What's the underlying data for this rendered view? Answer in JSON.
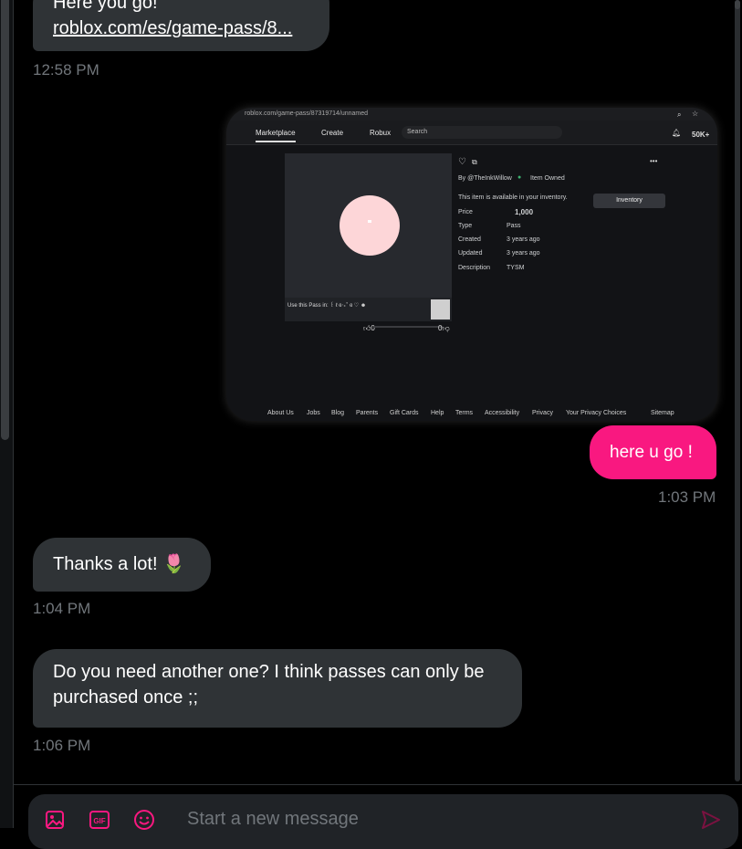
{
  "messages": {
    "first": {
      "line1": "Here you go!",
      "link": "roblox.com/es/game-pass/8...",
      "time": "12:58 PM"
    },
    "sent": {
      "text": "here u go !",
      "time": "1:03 PM"
    },
    "thanks": {
      "text": "Thanks a lot! 🌷",
      "time": "1:04 PM"
    },
    "question": {
      "line1": "Do you need another one? I think passes can only be",
      "line2": "purchased once ;;",
      "time": "1:06 PM"
    }
  },
  "shared_image": {
    "url": "roblox.com/game-pass/87319714/unnamed",
    "nav": [
      "Marketplace",
      "Create",
      "Robux"
    ],
    "search": "Search",
    "robux_balance": "50K+",
    "by": "By @TheInkWillow",
    "owned": "Item Owned",
    "available": "This item is available in your inventory.",
    "inventory_button": "Inventory",
    "price_label": "Price",
    "price_value": "1,000",
    "type_label": "Type",
    "type_value": "Pass",
    "created_label": "Created",
    "created_value": "3 years ago",
    "updated_label": "Updated",
    "updated_value": "3 years ago",
    "description_label": "Description",
    "description_value": "TYSM",
    "caption": "Use this Pass in: ꒰ ℓ ɞ‧₊˚ ɞ ♡ ☻",
    "likes": "0",
    "dislikes": "0",
    "footer": [
      "About Us",
      "Jobs",
      "Blog",
      "Parents",
      "Gift Cards",
      "Help",
      "Terms",
      "Accessibility",
      "Privacy",
      "Your Privacy Choices",
      "Sitemap"
    ]
  },
  "composer": {
    "placeholder": "Start a new message",
    "gif_label": "GIF"
  },
  "colors": {
    "accent": "#f91880",
    "bubble_in": "#2f3336",
    "muted": "#71767b"
  }
}
